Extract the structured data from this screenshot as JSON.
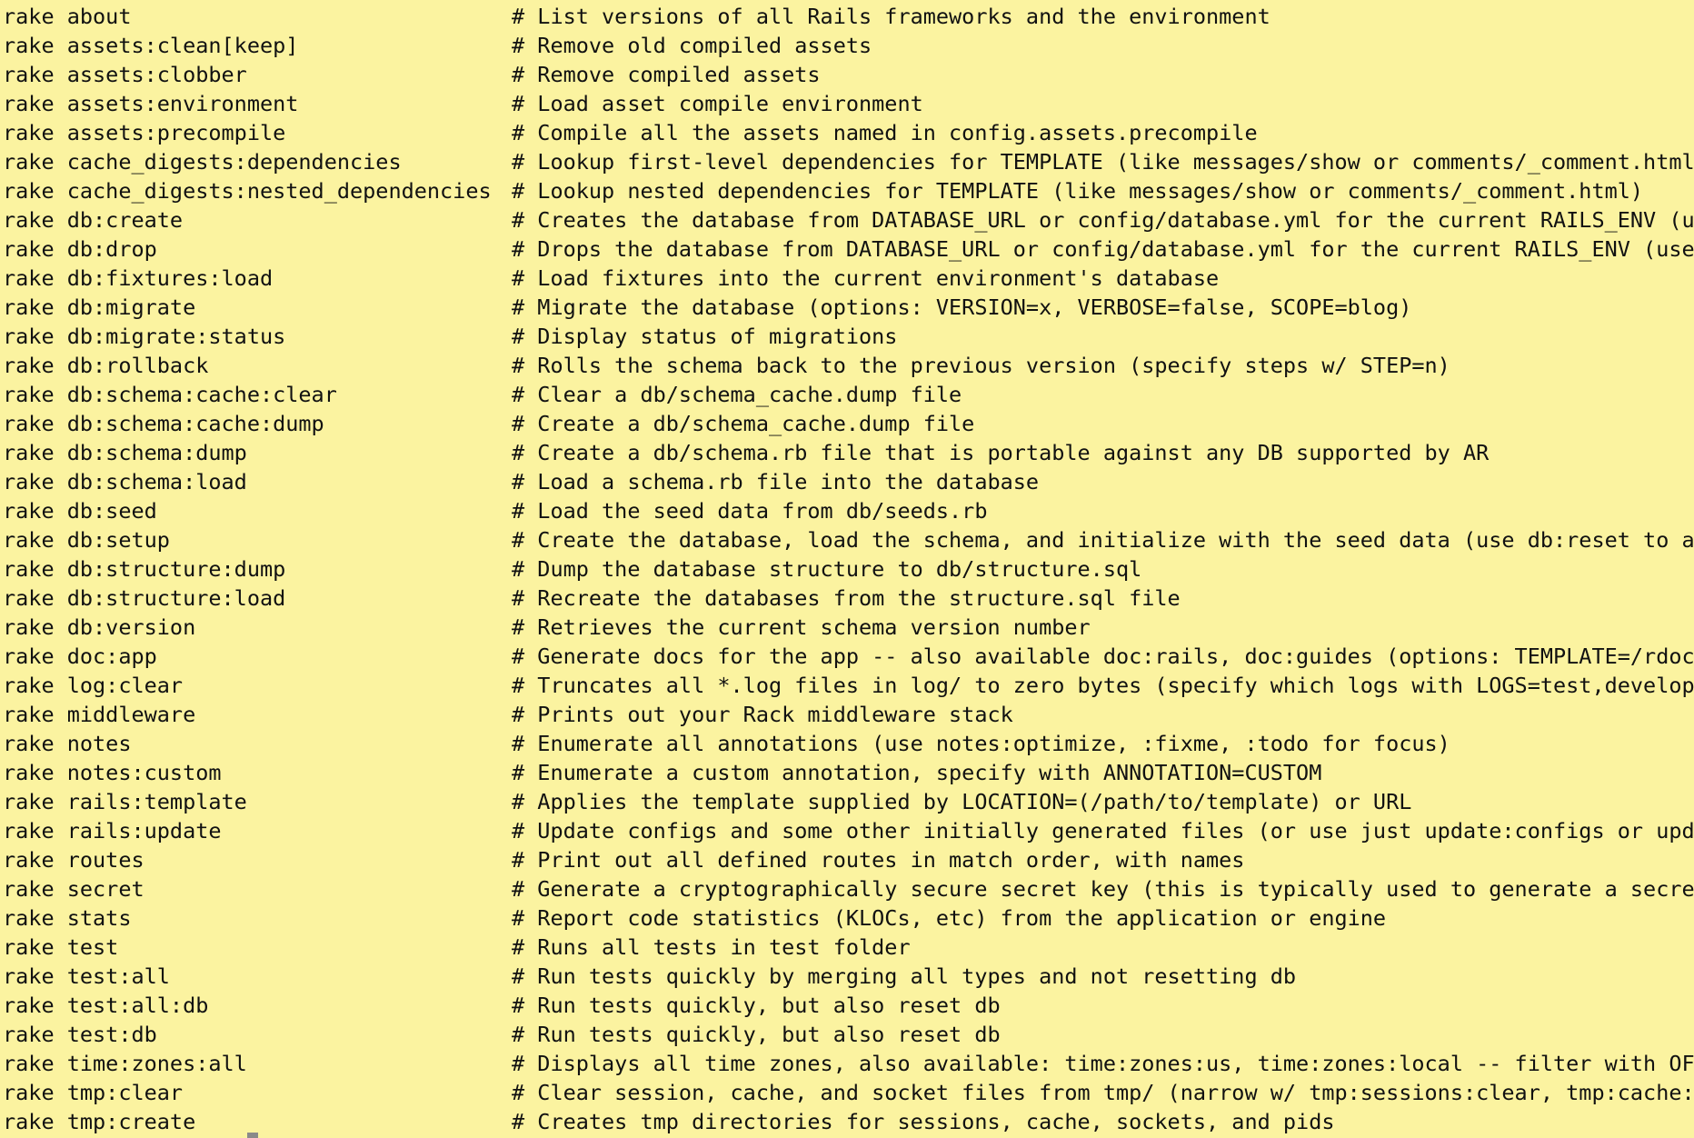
{
  "terminal": {
    "lines": [
      {
        "cmd": "rake about",
        "desc": "# List versions of all Rails frameworks and the environment"
      },
      {
        "cmd": "rake assets:clean[keep]",
        "desc": "# Remove old compiled assets"
      },
      {
        "cmd": "rake assets:clobber",
        "desc": "# Remove compiled assets"
      },
      {
        "cmd": "rake assets:environment",
        "desc": "# Load asset compile environment"
      },
      {
        "cmd": "rake assets:precompile",
        "desc": "# Compile all the assets named in config.assets.precompile"
      },
      {
        "cmd": "rake cache_digests:dependencies",
        "desc": "# Lookup first-level dependencies for TEMPLATE (like messages/show or comments/_comment.html)"
      },
      {
        "cmd": "rake cache_digests:nested_dependencies",
        "desc": "# Lookup nested dependencies for TEMPLATE (like messages/show or comments/_comment.html)"
      },
      {
        "cmd": "rake db:create",
        "desc": "# Creates the database from DATABASE_URL or config/database.yml for the current RAILS_ENV (us"
      },
      {
        "cmd": "rake db:drop",
        "desc": "# Drops the database from DATABASE_URL or config/database.yml for the current RAILS_ENV (use"
      },
      {
        "cmd": "rake db:fixtures:load",
        "desc": "# Load fixtures into the current environment's database"
      },
      {
        "cmd": "rake db:migrate",
        "desc": "# Migrate the database (options: VERSION=x, VERBOSE=false, SCOPE=blog)"
      },
      {
        "cmd": "rake db:migrate:status",
        "desc": "# Display status of migrations"
      },
      {
        "cmd": "rake db:rollback",
        "desc": "# Rolls the schema back to the previous version (specify steps w/ STEP=n)"
      },
      {
        "cmd": "rake db:schema:cache:clear",
        "desc": "# Clear a db/schema_cache.dump file"
      },
      {
        "cmd": "rake db:schema:cache:dump",
        "desc": "# Create a db/schema_cache.dump file"
      },
      {
        "cmd": "rake db:schema:dump",
        "desc": "# Create a db/schema.rb file that is portable against any DB supported by AR"
      },
      {
        "cmd": "rake db:schema:load",
        "desc": "# Load a schema.rb file into the database"
      },
      {
        "cmd": "rake db:seed",
        "desc": "# Load the seed data from db/seeds.rb"
      },
      {
        "cmd": "rake db:setup",
        "desc": "# Create the database, load the schema, and initialize with the seed data (use db:reset to al"
      },
      {
        "cmd": "rake db:structure:dump",
        "desc": "# Dump the database structure to db/structure.sql"
      },
      {
        "cmd": "rake db:structure:load",
        "desc": "# Recreate the databases from the structure.sql file"
      },
      {
        "cmd": "rake db:version",
        "desc": "# Retrieves the current schema version number"
      },
      {
        "cmd": "rake doc:app",
        "desc": "# Generate docs for the app -- also available doc:rails, doc:guides (options: TEMPLATE=/rdoc-"
      },
      {
        "cmd": "rake log:clear",
        "desc": "# Truncates all *.log files in log/ to zero bytes (specify which logs with LOGS=test,developm"
      },
      {
        "cmd": "rake middleware",
        "desc": "# Prints out your Rack middleware stack"
      },
      {
        "cmd": "rake notes",
        "desc": "# Enumerate all annotations (use notes:optimize, :fixme, :todo for focus)"
      },
      {
        "cmd": "rake notes:custom",
        "desc": "# Enumerate a custom annotation, specify with ANNOTATION=CUSTOM"
      },
      {
        "cmd": "rake rails:template",
        "desc": "# Applies the template supplied by LOCATION=(/path/to/template) or URL"
      },
      {
        "cmd": "rake rails:update",
        "desc": "# Update configs and some other initially generated files (or use just update:configs or upda"
      },
      {
        "cmd": "rake routes",
        "desc": "# Print out all defined routes in match order, with names"
      },
      {
        "cmd": "rake secret",
        "desc": "# Generate a cryptographically secure secret key (this is typically used to generate a secret"
      },
      {
        "cmd": "rake stats",
        "desc": "# Report code statistics (KLOCs, etc) from the application or engine"
      },
      {
        "cmd": "rake test",
        "desc": "# Runs all tests in test folder"
      },
      {
        "cmd": "rake test:all",
        "desc": "# Run tests quickly by merging all types and not resetting db"
      },
      {
        "cmd": "rake test:all:db",
        "desc": "# Run tests quickly, but also reset db"
      },
      {
        "cmd": "rake test:db",
        "desc": "# Run tests quickly, but also reset db"
      },
      {
        "cmd": "rake time:zones:all",
        "desc": "# Displays all time zones, also available: time:zones:us, time:zones:local -- filter with OFF"
      },
      {
        "cmd": "rake tmp:clear",
        "desc": "# Clear session, cache, and socket files from tmp/ (narrow w/ tmp:sessions:clear, tmp:cache:c"
      },
      {
        "cmd": "rake tmp:create",
        "desc": "# Creates tmp directories for sessions, cache, sockets, and pids"
      }
    ]
  }
}
